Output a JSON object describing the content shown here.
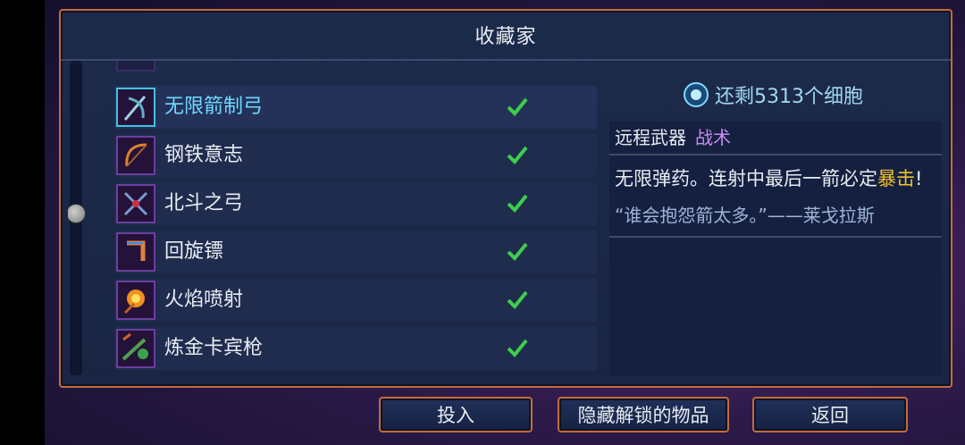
{
  "panel": {
    "title": "收藏家"
  },
  "items": [
    {
      "name": "无限箭制弓",
      "state": "selected",
      "icon": "bow-icon"
    },
    {
      "name": "钢铁意志",
      "state": "normal",
      "icon": "iron-bow-icon"
    },
    {
      "name": "北斗之弓",
      "state": "normal",
      "icon": "crossbow-icon"
    },
    {
      "name": "回旋镖",
      "state": "normal",
      "icon": "boomerang-icon"
    },
    {
      "name": "火焰喷射",
      "state": "normal",
      "icon": "flamethrower-icon"
    },
    {
      "name": "炼金卡宾枪",
      "state": "normal",
      "icon": "alchemic-carbine-icon"
    }
  ],
  "cells": {
    "text": "还剩5313个细胞",
    "icon": "cell-icon"
  },
  "detail": {
    "category": "远程武器",
    "subcategory": "战术",
    "desc_main": "无限弹药。连射中最后一箭必定",
    "desc_crit": "暴击",
    "desc_end": "!",
    "quote": "“谁会抱怨箭太多。”——莱戈拉斯"
  },
  "buttons": {
    "invest": "投入",
    "hide_unlocked": "隐藏解锁的物品",
    "back": "返回"
  },
  "colors": {
    "frame": "#c46b3a",
    "selected_text": "#6fd8ff",
    "check": "#3ccf4a",
    "crit": "#f0c030",
    "subcategory": "#c88cf0"
  }
}
